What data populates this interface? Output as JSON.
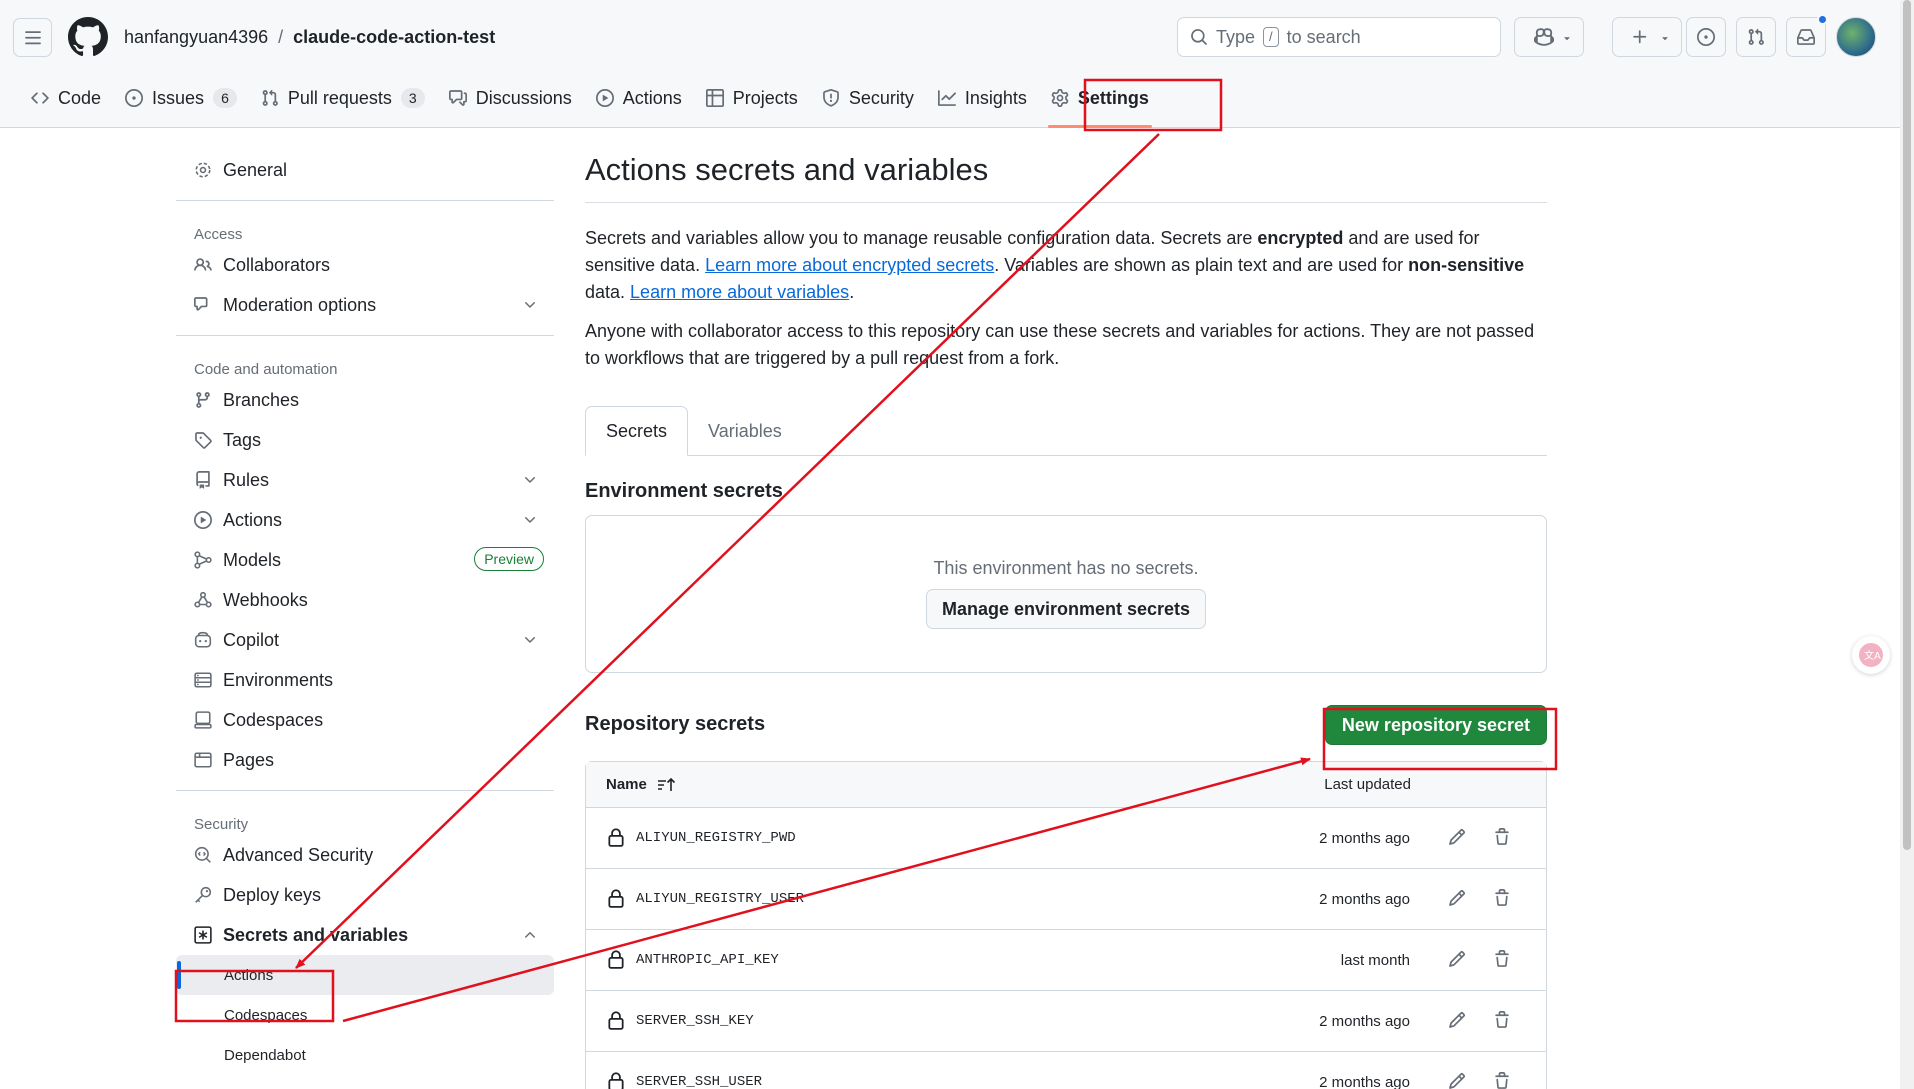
{
  "header": {
    "owner": "hanfangyuan4396",
    "separator": "/",
    "repo": "claude-code-action-test",
    "search_prefix": "Type",
    "search_key": "/",
    "search_suffix": "to search"
  },
  "repo_tabs": [
    {
      "label": "Code",
      "icon": "code-icon"
    },
    {
      "label": "Issues",
      "count": "6",
      "icon": "issue-icon"
    },
    {
      "label": "Pull requests",
      "count": "3",
      "icon": "pull-request-icon"
    },
    {
      "label": "Discussions",
      "icon": "discussions-icon"
    },
    {
      "label": "Actions",
      "icon": "play-icon"
    },
    {
      "label": "Projects",
      "icon": "table-icon"
    },
    {
      "label": "Security",
      "icon": "shield-icon"
    },
    {
      "label": "Insights",
      "icon": "graph-icon"
    },
    {
      "label": "Settings",
      "icon": "gear-icon",
      "active": true
    }
  ],
  "sidebar": {
    "general": "General",
    "access_heading": "Access",
    "collaborators": "Collaborators",
    "moderation": "Moderation options",
    "code_heading": "Code and automation",
    "branches": "Branches",
    "tags": "Tags",
    "rules": "Rules",
    "actions": "Actions",
    "models": "Models",
    "models_badge": "Preview",
    "webhooks": "Webhooks",
    "copilot": "Copilot",
    "environments": "Environments",
    "codespaces": "Codespaces",
    "pages": "Pages",
    "security_heading": "Security",
    "advanced_security": "Advanced Security",
    "deploy_keys": "Deploy keys",
    "secrets_vars": "Secrets and variables",
    "sub_actions": "Actions",
    "sub_codespaces": "Codespaces",
    "sub_dependabot": "Dependabot"
  },
  "main": {
    "title": "Actions secrets and variables",
    "desc1_a": "Secrets and variables allow you to manage reusable configuration data. Secrets are ",
    "desc1_b": "encrypted",
    "desc1_c": " and are used for sensitive data. ",
    "desc1_link1": "Learn more about encrypted secrets",
    "desc1_d": ". Variables are shown as plain text and are used for ",
    "desc1_e": "non-sensitive",
    "desc1_f": " data. ",
    "desc1_link2": "Learn more about variables",
    "desc1_g": ".",
    "desc2": "Anyone with collaborator access to this repository can use these secrets and variables for actions. They are not passed to workflows that are triggered by a pull request from a fork.",
    "tab_secrets": "Secrets",
    "tab_variables": "Variables",
    "env_title": "Environment secrets",
    "env_empty": "This environment has no secrets.",
    "env_button": "Manage environment secrets",
    "repo_title": "Repository secrets",
    "new_secret_button": "New repository secret",
    "col_name": "Name",
    "col_updated": "Last updated",
    "secrets": [
      {
        "name": "ALIYUN_REGISTRY_PWD",
        "updated": "2 months ago"
      },
      {
        "name": "ALIYUN_REGISTRY_USER",
        "updated": "2 months ago"
      },
      {
        "name": "ANTHROPIC_API_KEY",
        "updated": "last month"
      },
      {
        "name": "SERVER_SSH_KEY",
        "updated": "2 months ago"
      },
      {
        "name": "SERVER_SSH_USER",
        "updated": "2 months ago"
      }
    ]
  },
  "colors": {
    "accent": "#0969da",
    "green": "#1f883d",
    "annotation": "#e0101d",
    "tab_underline": "#fd8c73"
  }
}
